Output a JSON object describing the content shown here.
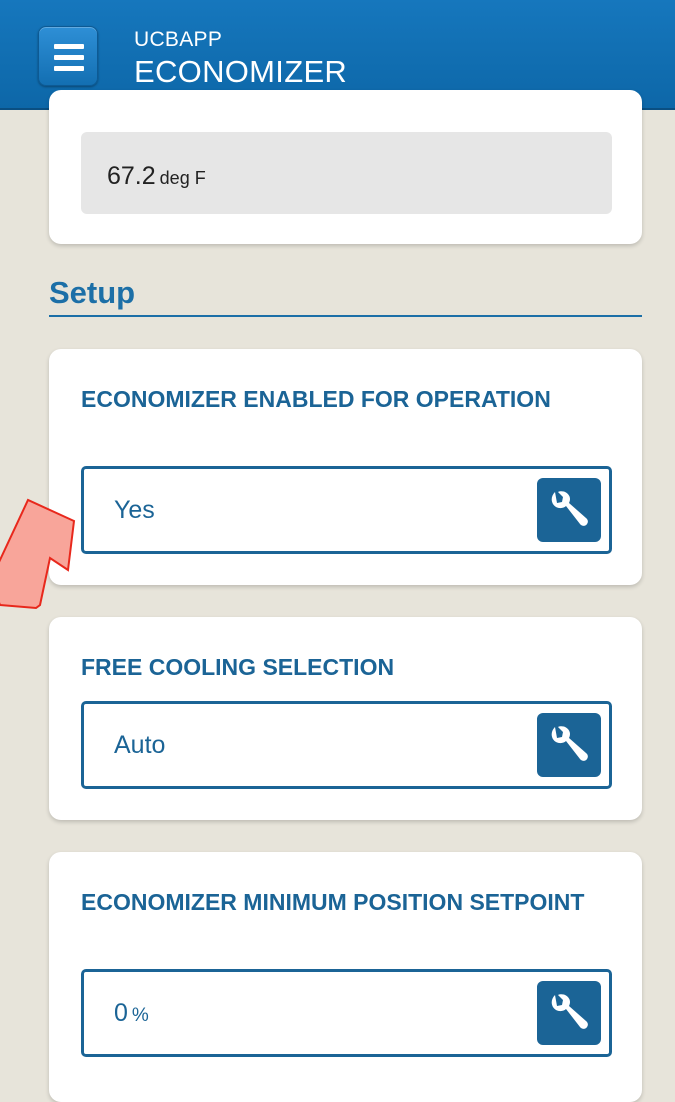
{
  "header": {
    "app_name": "UCBAPP",
    "title": "ECONOMIZER"
  },
  "top_card": {
    "value": "67.2",
    "unit": "deg F"
  },
  "section": {
    "title": "Setup"
  },
  "settings": [
    {
      "label": "ECONOMIZER ENABLED FOR OPERATION",
      "value": "Yes",
      "unit": ""
    },
    {
      "label": "FREE COOLING SELECTION",
      "value": "Auto",
      "unit": ""
    },
    {
      "label": "ECONOMIZER MINIMUM POSITION SETPOINT",
      "value": "0",
      "unit": "%"
    }
  ],
  "icons": {
    "menu": "hamburger-menu-icon",
    "edit": "wrench-icon",
    "annotation": "red-pointer-arrow"
  },
  "colors": {
    "header_blue": "#1677bd",
    "accent_blue": "#1b6496",
    "background": "#e7e4da",
    "arrow_fill": "#f8a59a",
    "arrow_stroke": "#e8281c"
  }
}
